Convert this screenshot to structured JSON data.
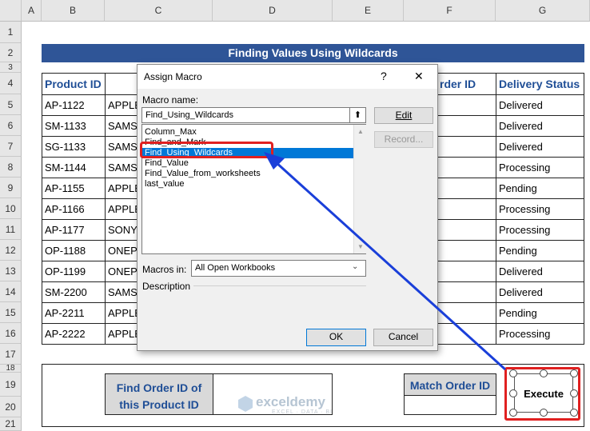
{
  "sheet": {
    "columns": [
      "A",
      "B",
      "C",
      "D",
      "E",
      "F",
      "G"
    ],
    "rows": [
      "1",
      "2",
      "3",
      "4",
      "5",
      "6",
      "7",
      "8",
      "9",
      "10",
      "11",
      "12",
      "13",
      "14",
      "15",
      "16",
      "17",
      "18",
      "19",
      "20",
      "21"
    ],
    "title": "Finding Values Using Wildcards",
    "headers": {
      "product_id": "Product ID",
      "order_id_partial": "rder ID",
      "delivery_status": "Delivery Status"
    },
    "product_ids": [
      "AP-1122",
      "SM-1133",
      "SG-1133",
      "SM-1144",
      "AP-1155",
      "AP-1166",
      "AP-1177",
      "OP-1188",
      "OP-1199",
      "SM-2200",
      "AP-2211",
      "AP-2222"
    ],
    "brands_partial": [
      "APPLE",
      "SAMS",
      "SAMS",
      "SAMS",
      "APPLE",
      "APPLE",
      "SONY",
      "ONEP",
      "ONEP",
      "SAMS",
      "APPLE",
      "APPLE"
    ],
    "statuses": [
      "Delivered",
      "Delivered",
      "Delivered",
      "Processing",
      "Pending",
      "Processing",
      "Processing",
      "Pending",
      "Delivered",
      "Delivered",
      "Pending",
      "Processing"
    ],
    "find_label_line1": "Find Order ID of",
    "find_label_line2": "this Product ID",
    "match_label": "Match Order ID",
    "execute_label": "Execute",
    "watermark_name": "exceldemy",
    "watermark_tag": "EXCEL · DATA · BI"
  },
  "dialog": {
    "title": "Assign Macro",
    "help": "?",
    "close": "✕",
    "macro_name_label": "Macro name:",
    "macro_name_value": "Find_Using_Wildcards",
    "macros": [
      "Column_Max",
      "Find_and_Mark",
      "Find_Using_Wildcards",
      "Find_Value",
      "Find_Value_from_worksheets",
      "last_value"
    ],
    "selected_index": 2,
    "edit_label": "Edit",
    "record_label": "Record...",
    "macros_in_label": "Macros in:",
    "macros_in_value": "All Open Workbooks",
    "description_label": "Description",
    "ok_label": "OK",
    "cancel_label": "Cancel"
  },
  "colors": {
    "title_bar": "#2f5597",
    "header_text": "#1f4e96",
    "highlight": "#e02020",
    "arrow": "#1a3fd9",
    "selection": "#0078d7"
  }
}
